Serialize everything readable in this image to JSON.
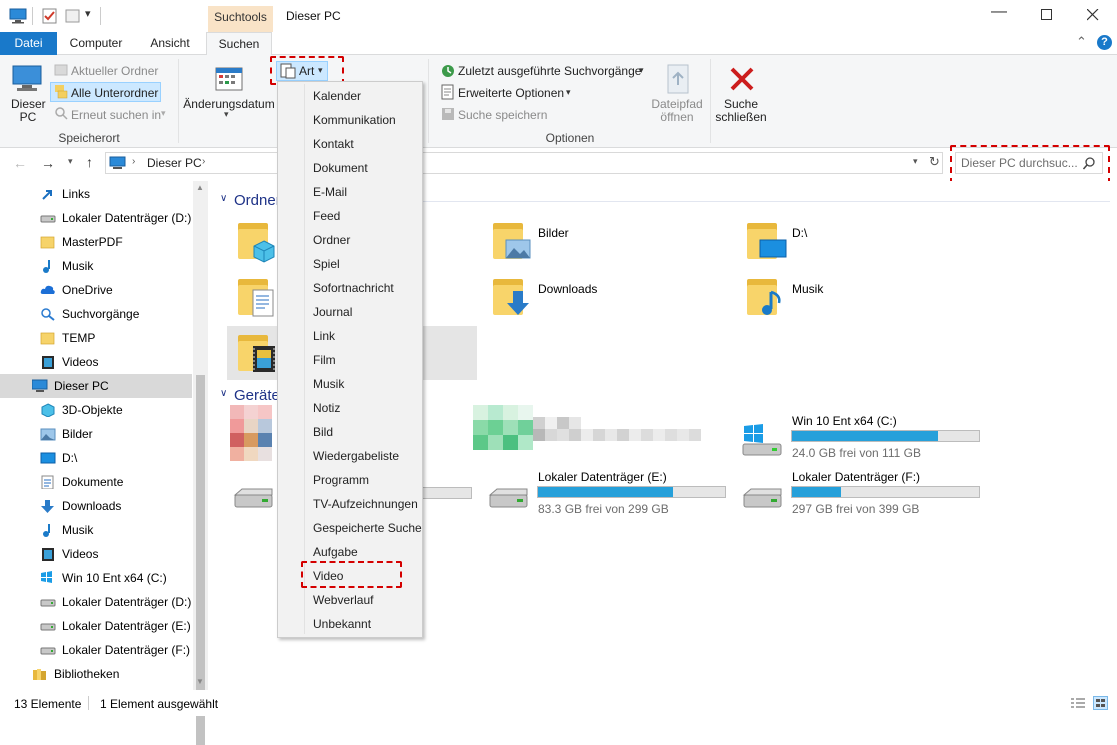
{
  "window": {
    "title": "Dieser PC",
    "context_tab": "Suchtools"
  },
  "tabs": {
    "datei": "Datei",
    "computer": "Computer",
    "ansicht": "Ansicht",
    "suchen": "Suchen"
  },
  "ribbon": {
    "dieser_pc": "Dieser\nPC",
    "dieser_pc_l1": "Dieser",
    "dieser_pc_l2": "PC",
    "aktueller_ordner": "Aktueller Ordner",
    "alle_unterordner": "Alle Unterordner",
    "erneut_suchen": "Erneut suchen in",
    "speicherort": "Speicherort",
    "aenderungsdatum": "Änderungsdatum",
    "art": "Art",
    "zuletzt": "Zuletzt ausgeführte Suchvorgänge",
    "erweitert": "Erweiterte Optionen",
    "speichern": "Suche speichern",
    "dateipfad_l1": "Dateipfad",
    "dateipfad_l2": "öffnen",
    "schliessen_l1": "Suche",
    "schliessen_l2": "schließen",
    "optionen": "Optionen"
  },
  "address": {
    "path": "Dieser PC",
    "search_placeholder": "Dieser PC durchsuc..."
  },
  "nav": {
    "items": [
      {
        "label": "Links",
        "icon": "arrow-link-icon"
      },
      {
        "label": "Lokaler Datenträger (D:)",
        "icon": "drive-icon"
      },
      {
        "label": "MasterPDF",
        "icon": "folder-icon"
      },
      {
        "label": "Musik",
        "icon": "music-icon"
      },
      {
        "label": "OneDrive",
        "icon": "cloud-icon"
      },
      {
        "label": "Suchvorgänge",
        "icon": "search-icon"
      },
      {
        "label": "TEMP",
        "icon": "folder-icon"
      },
      {
        "label": "Videos",
        "icon": "video-icon"
      },
      {
        "label": "Dieser PC",
        "icon": "computer-icon"
      },
      {
        "label": "3D-Objekte",
        "icon": "cube-icon"
      },
      {
        "label": "Bilder",
        "icon": "pictures-icon"
      },
      {
        "label": "D:\\",
        "icon": "desktop-icon"
      },
      {
        "label": "Dokumente",
        "icon": "document-icon"
      },
      {
        "label": "Downloads",
        "icon": "download-icon"
      },
      {
        "label": "Musik",
        "icon": "music-icon"
      },
      {
        "label": "Videos",
        "icon": "video-icon"
      },
      {
        "label": "Win 10 Ent x64 (C:)",
        "icon": "windows-drive-icon"
      },
      {
        "label": "Lokaler Datenträger (D:)",
        "icon": "drive-icon"
      },
      {
        "label": "Lokaler Datenträger (E:)",
        "icon": "drive-icon"
      },
      {
        "label": "Lokaler Datenträger (F:)",
        "icon": "drive-icon"
      },
      {
        "label": "Bibliotheken",
        "icon": "library-icon"
      }
    ]
  },
  "content": {
    "ordner_header": "Ordner",
    "geraete_header": "Geräte",
    "folders": {
      "bilder": "Bilder",
      "d": "D:\\",
      "downloads": "Downloads",
      "musik": "Musik"
    },
    "drives": {
      "c": {
        "name": "Win 10 Ent x64 (C:)",
        "free": "24.0 GB frei von 111 GB",
        "used_fraction": 0.78
      },
      "e": {
        "name": "Lokaler Datenträger (E:)",
        "free": "83.3 GB frei von 299 GB",
        "used_fraction": 0.72
      },
      "f": {
        "name": "Lokaler Datenträger (F:)",
        "free": "297 GB frei von 399 GB",
        "used_fraction": 0.26
      },
      "hidden": {
        "used_fraction": 0.0
      }
    }
  },
  "dropdown": {
    "items": [
      "Kalender",
      "Kommunikation",
      "Kontakt",
      "Dokument",
      "E-Mail",
      "Feed",
      "Ordner",
      "Spiel",
      "Sofortnachricht",
      "Journal",
      "Link",
      "Film",
      "Musik",
      "Notiz",
      "Bild",
      "Wiedergabeliste",
      "Programm",
      "TV-Aufzeichnungen",
      "Gespeicherte Suche",
      "Aufgabe",
      "Video",
      "Webverlauf",
      "Unbekannt"
    ]
  },
  "status": {
    "count": "13 Elemente",
    "selected": "1 Element ausgewählt"
  },
  "colors": {
    "accent": "#1979ca",
    "highlight_dash": "#d40000",
    "selected_row": "#cce8ff",
    "bar_fill": "#26a0da"
  }
}
